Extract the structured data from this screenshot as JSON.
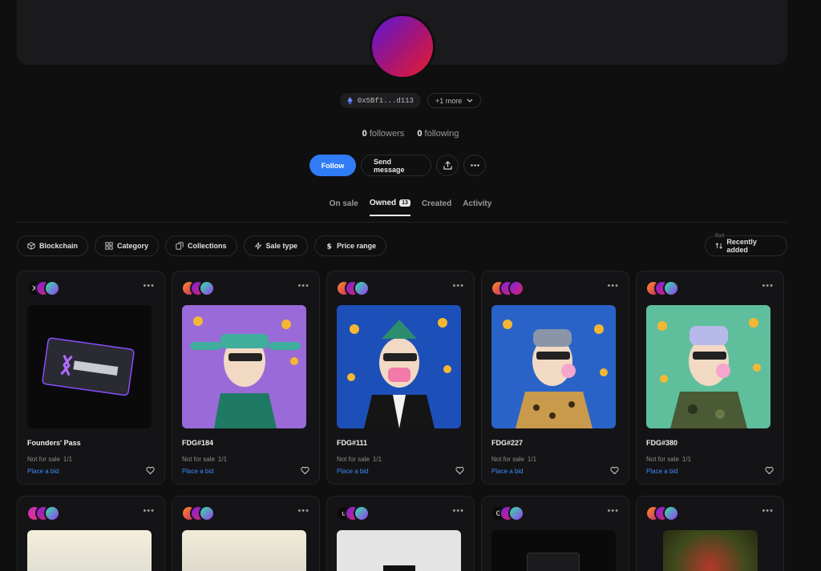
{
  "profile": {
    "address": "0x5Bf1...d113",
    "more_label": "+1 more",
    "followers_count": "0",
    "followers_label": "followers",
    "following_count": "0",
    "following_label": "following"
  },
  "actions": {
    "follow": "Follow",
    "send_message": "Send message"
  },
  "tabs": [
    {
      "label": "On sale"
    },
    {
      "label": "Owned",
      "badge": "13"
    },
    {
      "label": "Created"
    },
    {
      "label": "Activity"
    }
  ],
  "filters": [
    "Blockchain",
    "Category",
    "Collections",
    "Sale type",
    "Price range"
  ],
  "sort": {
    "label": "Sort",
    "value": "Recently added"
  },
  "cards": [
    {
      "name": "Founders' Pass",
      "status": "Not for sale",
      "edition": "1/1",
      "bid": "Place a bid"
    },
    {
      "name": "FDG#184",
      "status": "Not for sale",
      "edition": "1/1",
      "bid": "Place a bid"
    },
    {
      "name": "FDG#111",
      "status": "Not for sale",
      "edition": "1/1",
      "bid": "Place a bid"
    },
    {
      "name": "FDG#227",
      "status": "Not for sale",
      "edition": "1/1",
      "bid": "Place a bid"
    },
    {
      "name": "FDG#380",
      "status": "Not for sale",
      "edition": "1/1",
      "bid": "Place a bid"
    }
  ],
  "colors": {
    "accent": "#2f7cf6",
    "bid_link": "#3d8bf7",
    "background": "#0f0f10"
  }
}
